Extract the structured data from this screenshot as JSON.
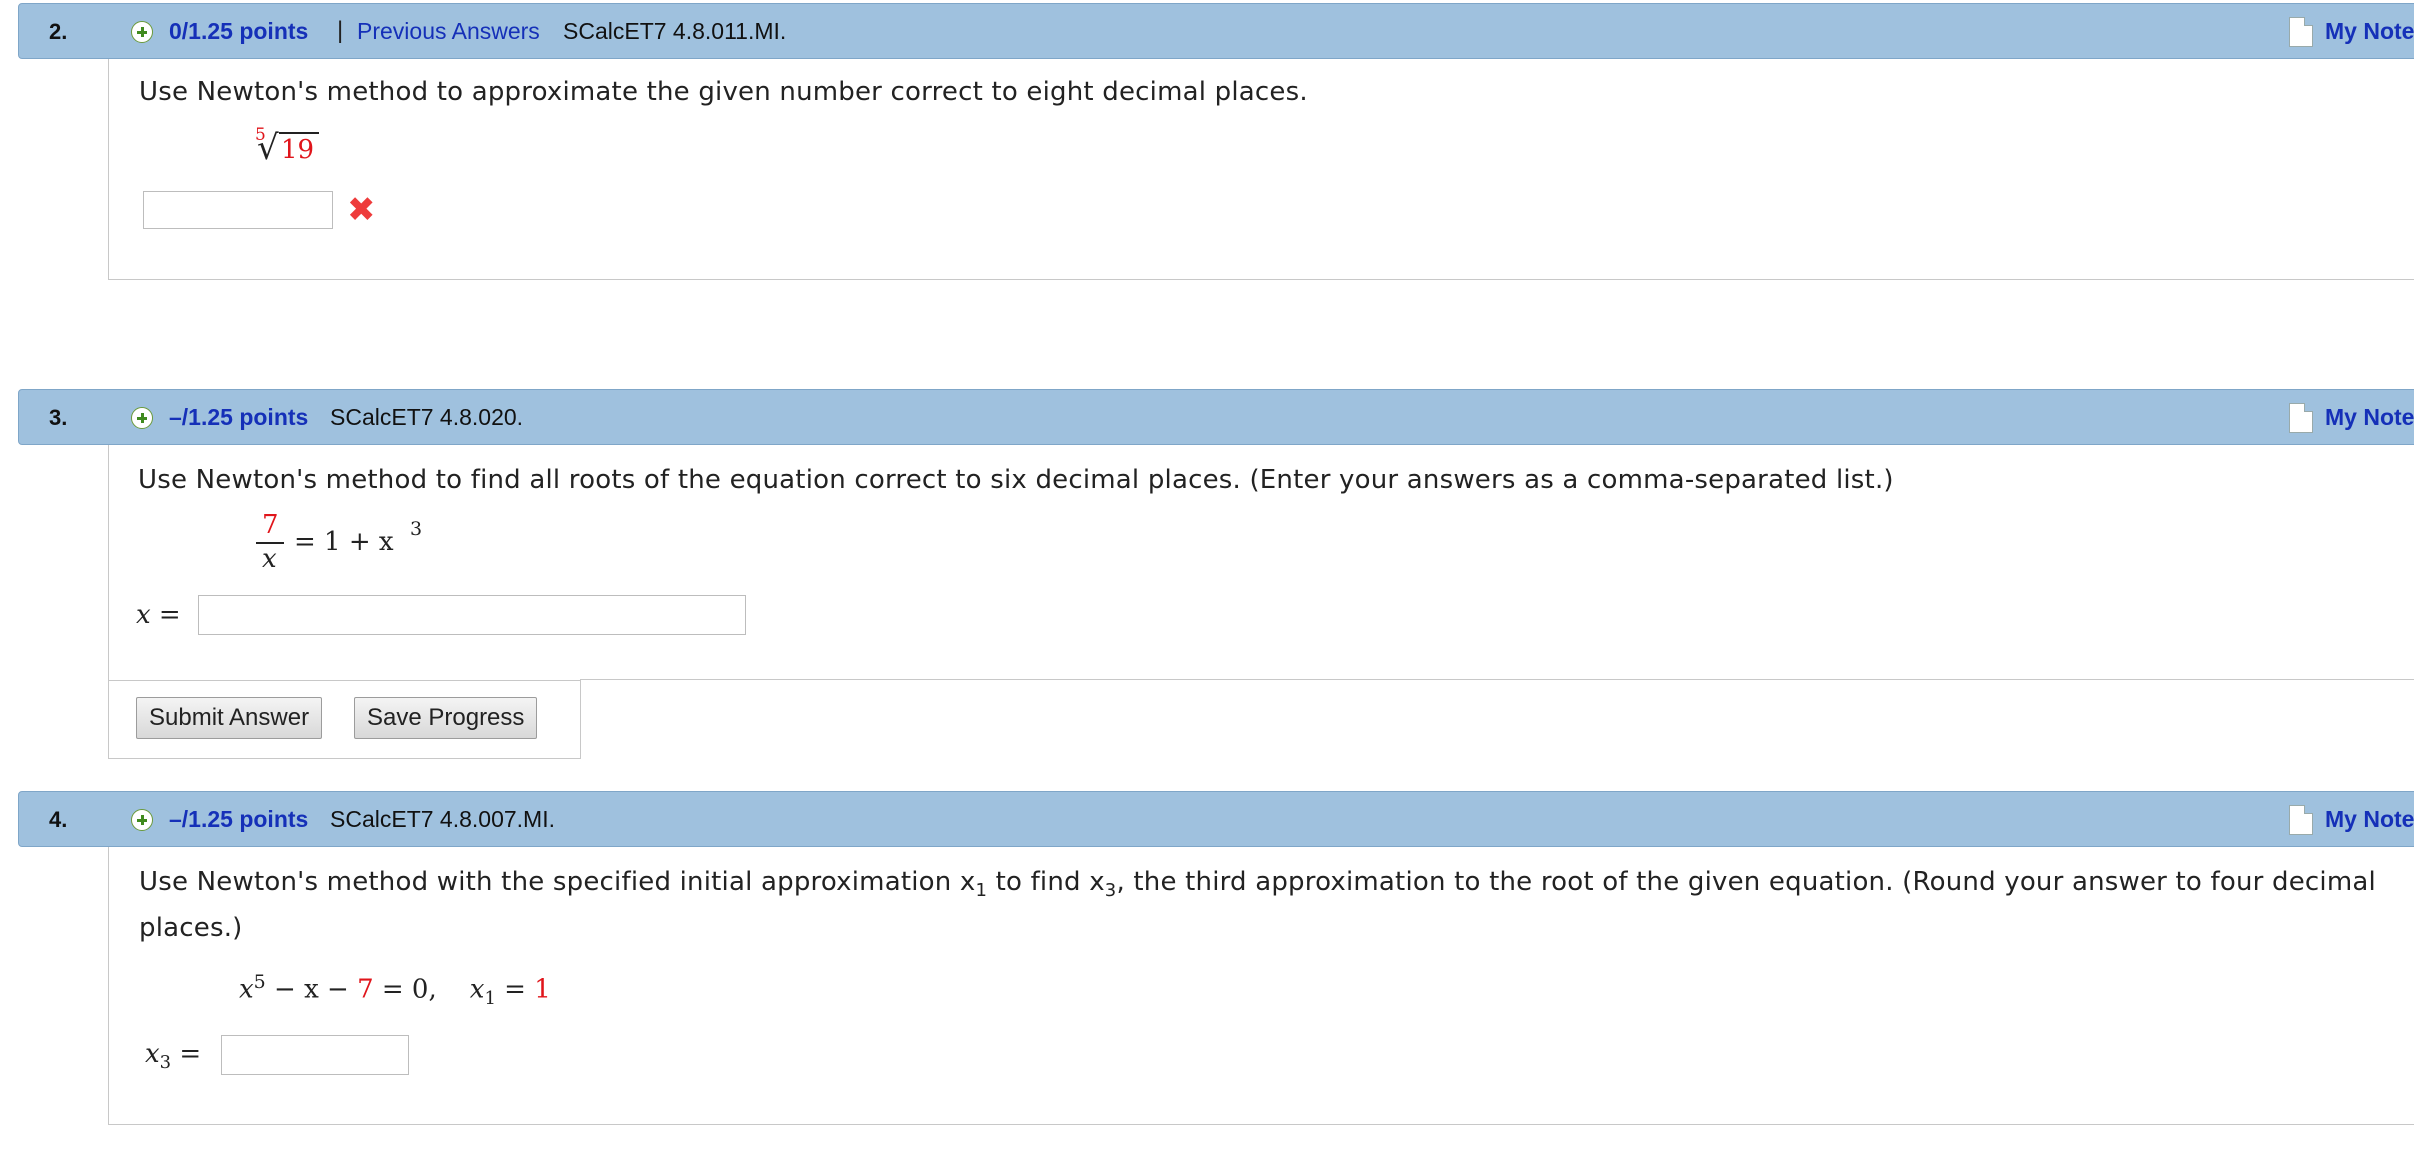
{
  "questions": [
    {
      "number": "2.",
      "points": "0/1.25 points",
      "separator": "|",
      "previous_answers": "Previous Answers",
      "code": "SCalcET7 4.8.011.MI.",
      "my_notes": "My Notes",
      "prompt": "Use Newton's method to approximate the given number correct to eight decimal places.",
      "math": {
        "root_index": "5",
        "radicand": "19"
      },
      "answer_value": "",
      "status": "incorrect",
      "status_icon": "x-mark-icon"
    },
    {
      "number": "3.",
      "points": "–/1.25 points",
      "code": "SCalcET7 4.8.020.",
      "my_notes": "My Notes",
      "prompt": "Use Newton's method to find all roots of the equation correct to six decimal places. (Enter your answers as a comma-separated list.)",
      "math": {
        "numerator": "7",
        "denominator": "x",
        "rhs": "= 1 + x",
        "exponent": "3"
      },
      "answer_label": "x =",
      "answer_value": "",
      "buttons": {
        "submit": "Submit Answer",
        "save": "Save Progress"
      }
    },
    {
      "number": "4.",
      "points": "–/1.25 points",
      "code": "SCalcET7 4.8.007.MI.",
      "my_notes": "My Notes",
      "prompt_line1": "Use Newton's method with the specified initial approximation x",
      "prompt_sub1": "1",
      "prompt_mid": " to find x",
      "prompt_sub2": "3",
      "prompt_end": ", the third approximation to the root of the given equation. (Round your answer to four decimal",
      "prompt_line2": "places.)",
      "math": {
        "x5": "x",
        "exp5": "5",
        "minus_x": " − x − ",
        "const": "7",
        "eq0": " = 0,",
        "x1": "x",
        "x1_sub": "1",
        "x1_eq": " = ",
        "x1_val": "1"
      },
      "answer_label_x": "x",
      "answer_label_sub": "3",
      "answer_label_eq": " =",
      "answer_value": ""
    }
  ],
  "colors": {
    "header_bg": "#9fc1de",
    "link": "#1530b8",
    "math_red": "#e0151b",
    "x_mark": "#ee3b3b"
  }
}
